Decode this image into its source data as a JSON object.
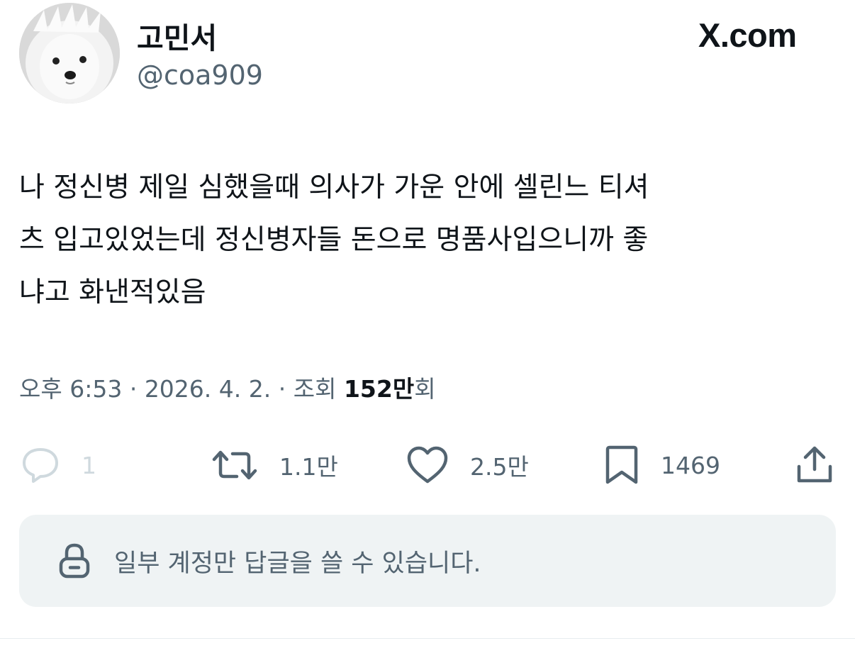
{
  "author": {
    "display_name": "고민서",
    "handle": "@coa909",
    "avatar_icon": "dog-avatar-icon"
  },
  "brand": {
    "label": "X.com"
  },
  "tweet": {
    "lines": [
      "나 정신병 제일 심했을때 의사가 가운 안에 셀린느 티셔",
      "츠 입고있었는데 정신병자들 돈으로 명품사입으니까 좋",
      "냐고 화낸적있음"
    ]
  },
  "meta": {
    "time": "오후 6:53",
    "separator": " · ",
    "date": "2026. 4. 2.",
    "views_label": "조회",
    "views_count": "152만",
    "views_suffix": "회"
  },
  "actions": {
    "reply": {
      "icon": "reply-bubble-icon",
      "count": "1"
    },
    "retweet": {
      "icon": "retweet-icon",
      "count": "1.1만"
    },
    "like": {
      "icon": "heart-icon",
      "count": "2.5만"
    },
    "bookmark": {
      "icon": "bookmark-icon",
      "count": "1469"
    },
    "share": {
      "icon": "share-icon"
    }
  },
  "reply_restriction": {
    "icon": "lock-icon",
    "message": "일부 계정만 답글을 쓸 수 있습니다."
  },
  "colors": {
    "text_primary": "#0f1419",
    "text_secondary": "#536471",
    "disabled": "#cfd9de",
    "restriction_bg": "#eff3f4"
  }
}
